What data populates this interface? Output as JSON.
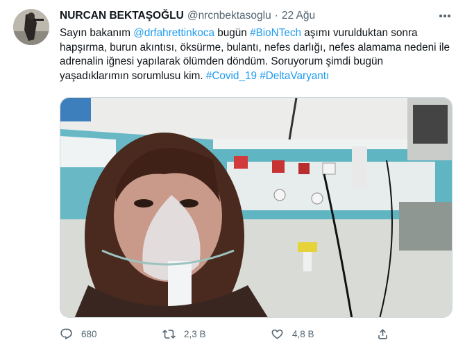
{
  "tweet": {
    "display_name": "NURCAN BEKTAŞOĞLU",
    "handle": "@nrcnbektasoglu",
    "separator": "·",
    "time": "22 Ağu",
    "text": {
      "p1": "Sayın bakanım ",
      "mention": "@drfahrettinkoca",
      "p2": " bugün ",
      "tag_biontech": "#BioNTech",
      "p3": " aşımı vurulduktan sonra hapşırma, burun akıntısı, öksürme, bulantı, nefes darlığı, nefes alamama nedeni ile adrenalin iğnesi yapılarak ölümden döndüm. Soruyorum şimdi bugün yaşadıklarımın sorumlusu kim. ",
      "tag_covid": "#Covid_19",
      "tag_delta": "#DeltaVaryantı"
    },
    "replies": "680",
    "retweets": "2,3 B",
    "likes": "4,8 B"
  },
  "icons": [
    "more-icon",
    "reply-icon",
    "retweet-icon",
    "like-icon",
    "share-icon"
  ],
  "colors": {
    "link": "#1d9bf0",
    "secondary_text": "#536471",
    "primary_text": "#0f1419"
  }
}
